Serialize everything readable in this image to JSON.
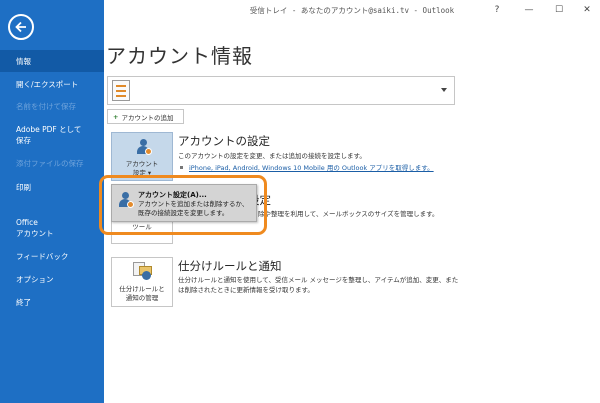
{
  "window": {
    "title": "受信トレイ - あなたのアカウント@saiki.tv - Outlook",
    "help": "?",
    "minimize": "—",
    "maximize": "☐",
    "close": "✕"
  },
  "sidebar": {
    "items": [
      {
        "label": "情報"
      },
      {
        "label": "開く/エクスポート"
      },
      {
        "label": "名前を付けて保存"
      },
      {
        "label": "Adobe PDF として"
      },
      {
        "label": "保存"
      },
      {
        "label": "添付ファイルの保存"
      },
      {
        "label": "印刷"
      },
      {
        "label": "Office"
      },
      {
        "label": "アカウント"
      },
      {
        "label": "フィードバック"
      },
      {
        "label": "オプション"
      },
      {
        "label": "終了"
      }
    ]
  },
  "main": {
    "title": "アカウント情報",
    "add_account": "アカウントの追加",
    "account_settings": {
      "button_line1": "アカウント",
      "button_line2": "設定 ▾",
      "title": "アカウントの設定",
      "desc": "このアカウントの設定を変更、または追加の接続を設定します。",
      "link": "iPhone, iPad, Android, Windows 10 Mobile 用の Outlook アプリを取得します。"
    },
    "mailbox": {
      "title_partial": "設定",
      "desc_partial": "除や整理を利用して、メールボックスのサイズを管理します。",
      "button_label": "ツール"
    },
    "rules": {
      "title": "仕分けルールと通知",
      "button_line1": "仕分けルールと",
      "button_line2": "通知の管理",
      "desc_line1": "仕分けルールと通知を使用して、受信メール メッセージを整理し、アイテムが追加、変更、また",
      "desc_line2": "は削除されたときに更新情報を受け取ります。"
    }
  },
  "popup": {
    "title": "アカウント設定(A)...",
    "desc_line1": "アカウントを追加または削除するか、",
    "desc_line2": "既存の接続設定を変更します。"
  }
}
